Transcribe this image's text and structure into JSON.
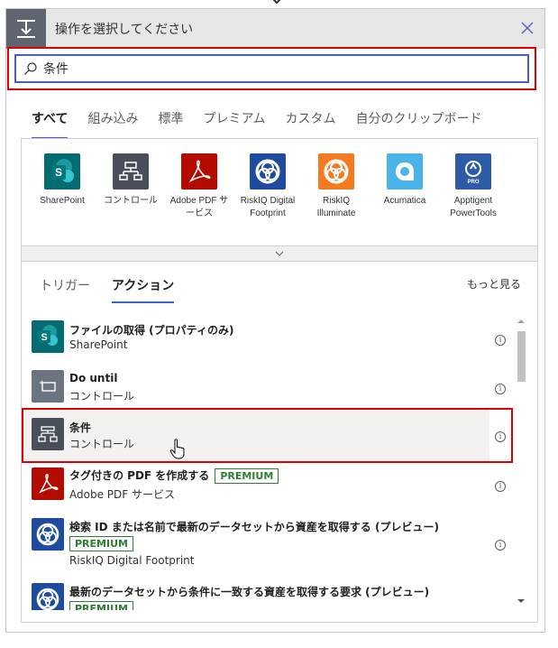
{
  "header": {
    "title": "操作を選択してください",
    "close_label": "×"
  },
  "search": {
    "value": "条件",
    "placeholder": ""
  },
  "tabs": [
    {
      "label": "すべて",
      "active": true
    },
    {
      "label": "組み込み"
    },
    {
      "label": "標準"
    },
    {
      "label": "プレミアム"
    },
    {
      "label": "カスタム"
    },
    {
      "label": "自分のクリップボード"
    }
  ],
  "connectors": [
    {
      "label": "SharePoint",
      "color": "#036c70",
      "icon": "sharepoint-icon"
    },
    {
      "label": "コントロール",
      "color": "#484f58",
      "icon": "control-icon"
    },
    {
      "label": "Adobe PDF サービス",
      "color": "#b30b00",
      "icon": "adobe-pdf-icon"
    },
    {
      "label": "RiskIQ Digital Footprint",
      "color": "#1d4ba0",
      "icon": "riskiq-icon"
    },
    {
      "label": "RiskIQ Illuminate",
      "color": "#f47b20",
      "icon": "riskiq-illuminate-icon"
    },
    {
      "label": "Acumatica",
      "color": "#4ab3e8",
      "icon": "acumatica-icon"
    },
    {
      "label": "Apptigent PowerTools",
      "color": "#2d5ba8",
      "icon": "apptigent-icon"
    }
  ],
  "subtabs": [
    {
      "label": "トリガー"
    },
    {
      "label": "アクション",
      "active": true
    }
  ],
  "more_label": "もっと見る",
  "actions": [
    {
      "title": "ファイルの取得 (プロパティのみ)",
      "subtitle": "SharePoint",
      "badge": ""
    },
    {
      "title": "Do until",
      "subtitle": "コントロール",
      "badge": ""
    },
    {
      "title": "条件",
      "subtitle": "コントロール",
      "badge": ""
    },
    {
      "title": "タグ付きの PDF を作成する",
      "subtitle": "Adobe PDF サービス",
      "badge": "PREMIUM"
    },
    {
      "title": "検索 ID または名前で最新のデータセットから資産を取得する (プレビュー)",
      "subtitle": "RiskIQ Digital Footprint",
      "badge": "PREMIUM"
    },
    {
      "title": "最新のデータセットから条件に一致する資産を取得する要求 (プレビュー)",
      "subtitle": "",
      "badge": "PREMIUM"
    }
  ],
  "colors": {
    "accent": "#3b66d0",
    "highlight": "#e00000",
    "premium": "#2e7d32"
  }
}
